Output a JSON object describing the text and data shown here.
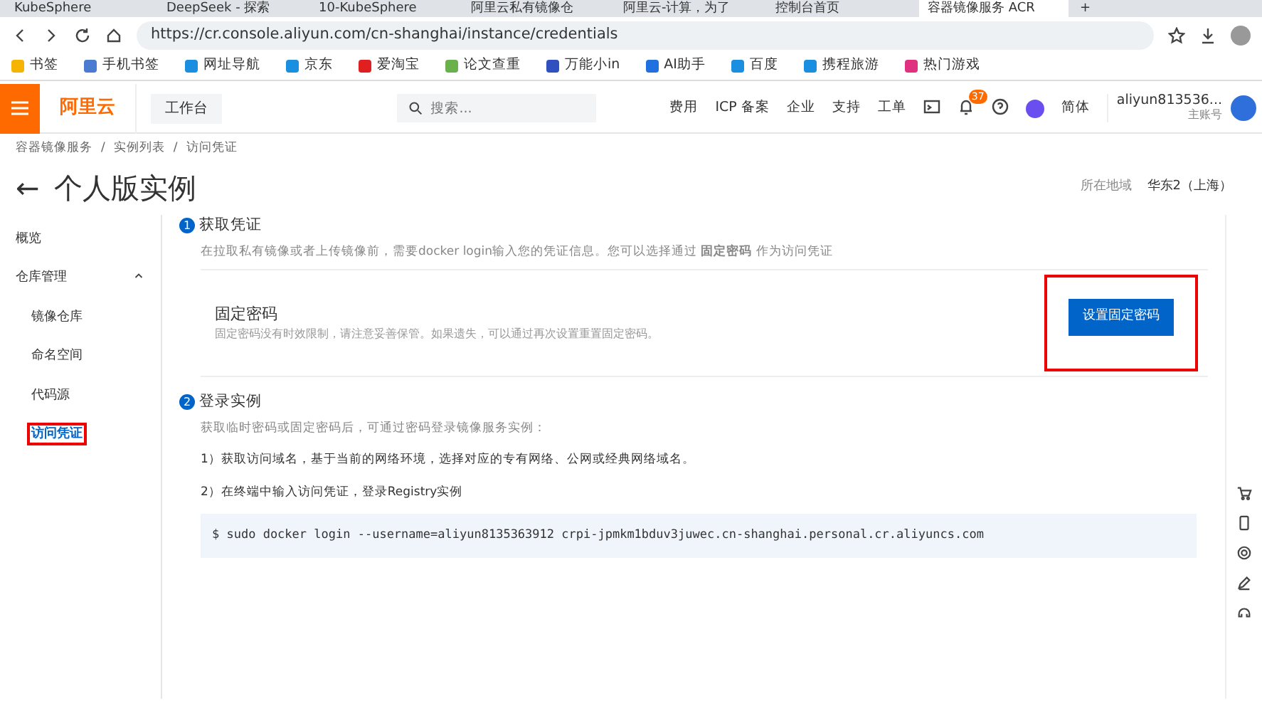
{
  "browser": {
    "tabs": [
      {
        "label": "KubeSphere",
        "selected": false
      },
      {
        "label": "DeepSeek - 探索",
        "selected": false
      },
      {
        "label": "10-KubeSphere",
        "selected": false
      },
      {
        "label": "阿里云私有镜像仓",
        "selected": false
      },
      {
        "label": "阿里云-计算，为了",
        "selected": false
      },
      {
        "label": "控制台首页",
        "selected": false
      },
      {
        "label": "容器镜像服务 ACR",
        "selected": true
      }
    ],
    "new_tab": "+",
    "url": "https://cr.console.aliyun.com/cn-shanghai/instance/credentials",
    "bookmarks": [
      "书签",
      "手机书签",
      "网址导航",
      "京东",
      "爱淘宝",
      "论文查重",
      "万能小in",
      "AI助手",
      "百度",
      "携程旅游",
      "热门游戏"
    ]
  },
  "header": {
    "logo": "阿里云",
    "workbench": "工作台",
    "search": {
      "placeholder": "搜索..."
    },
    "links": [
      "费用",
      "ICP 备案",
      "企业",
      "支持",
      "工单"
    ],
    "notification_count": "37",
    "language": "简体",
    "account": "aliyun813536...",
    "account_role": "主账号"
  },
  "breadcrumb": {
    "items": [
      "容器镜像服务",
      "实例列表",
      "访问凭证"
    ],
    "separator": "/"
  },
  "page": {
    "back": "←",
    "title": "个人版实例",
    "region_label": "所在地域",
    "region": "华东2（上海）"
  },
  "sidebar": {
    "items": [
      {
        "label": "概览",
        "selected": false,
        "highlighted": false
      },
      {
        "label": "仓库管理",
        "expanded": true,
        "children": [
          {
            "label": "镜像仓库",
            "selected": false,
            "highlighted": false
          },
          {
            "label": "命名空间",
            "selected": false,
            "highlighted": false
          },
          {
            "label": "代码源",
            "selected": false,
            "highlighted": false
          },
          {
            "label": "访问凭证",
            "selected": true,
            "highlighted": true
          }
        ]
      }
    ]
  },
  "steps": [
    {
      "number": "1",
      "title": "获取凭证",
      "description": "在拉取私有镜像或者上传镜像前，需要docker login输入您的凭证信息。您可以选择通过 **固定密码** 作为访问凭证",
      "card": {
        "title": "固定密码",
        "text": "固定密码没有时效限制，请注意妥善保管。如果遗失，可以通过再次设置重置固定密码。",
        "button": "设置固定密码",
        "highlighted": true
      }
    },
    {
      "number": "2",
      "title": "登录实例",
      "description": "获取临时密码或固定密码后，可通过密码登录镜像服务实例：",
      "instructions": [
        "1）获取访问域名，基于当前的网络环境，选择对应的专有网络、公网或经典网络域名。",
        "2）在终端中输入访问凭证，登录Registry实例"
      ],
      "command": "$ sudo docker login --username=aliyun8135363912 crpi-jpmkm1bduv3juwec.cn-shanghai.personal.cr.aliyuncs.com"
    }
  ]
}
